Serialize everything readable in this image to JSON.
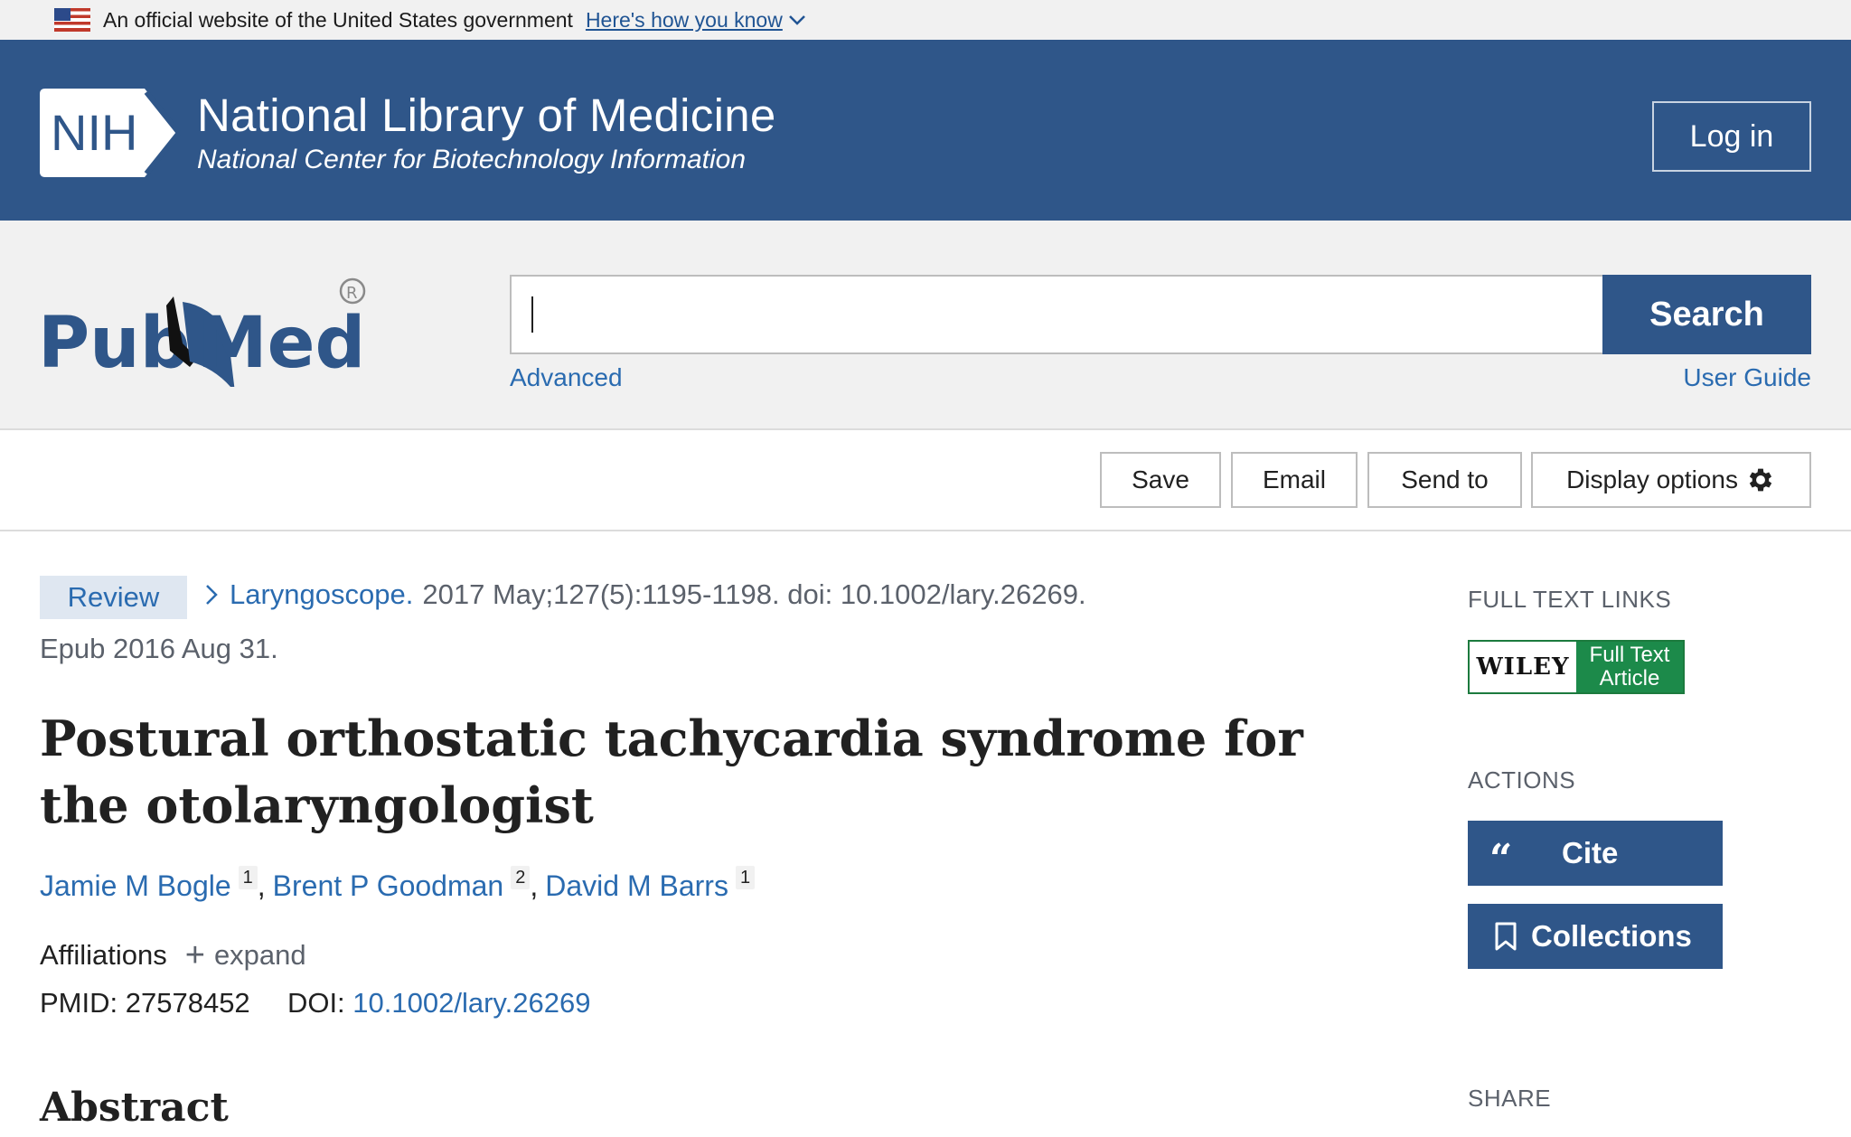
{
  "gov_banner": {
    "text": "An official website of the United States government",
    "link": "Here's how you know"
  },
  "nih": {
    "badge": "NIH",
    "title": "National Library of Medicine",
    "subtitle": "National Center for Biotechnology Information",
    "login": "Log in"
  },
  "pubmed": {
    "logo_text": "PubMed",
    "search_value": "",
    "search_button": "Search",
    "advanced": "Advanced",
    "user_guide": "User Guide"
  },
  "toolbar": {
    "save": "Save",
    "email": "Email",
    "send_to": "Send to",
    "display_options": "Display options"
  },
  "article": {
    "tag": "Review",
    "journal": "Laryngoscope.",
    "citation": "2017 May;127(5):1195-1198. doi: 10.1002/lary.26269.",
    "epub": "Epub 2016 Aug 31.",
    "title": "Postural orthostatic tachycardia syndrome for the otolaryngologist",
    "authors": [
      {
        "name": "Jamie M Bogle",
        "aff": "1"
      },
      {
        "name": "Brent P Goodman",
        "aff": "2"
      },
      {
        "name": "David M Barrs",
        "aff": "1"
      }
    ],
    "affiliations_label": "Affiliations",
    "expand_label": "expand",
    "pmid_label": "PMID:",
    "pmid": "27578452",
    "doi_label": "DOI:",
    "doi": "10.1002/lary.26269",
    "abstract_heading": "Abstract"
  },
  "sidebar": {
    "full_text_links": "FULL TEXT LINKS",
    "wiley_brand": "WILEY",
    "wiley_line1": "Full Text",
    "wiley_line2": "Article",
    "actions": "ACTIONS",
    "cite": "Cite",
    "collections": "Collections",
    "share": "SHARE"
  },
  "colors": {
    "nih_blue": "#2f5689",
    "link_blue": "#2a6bb0",
    "wiley_green": "#1c8a4a"
  }
}
